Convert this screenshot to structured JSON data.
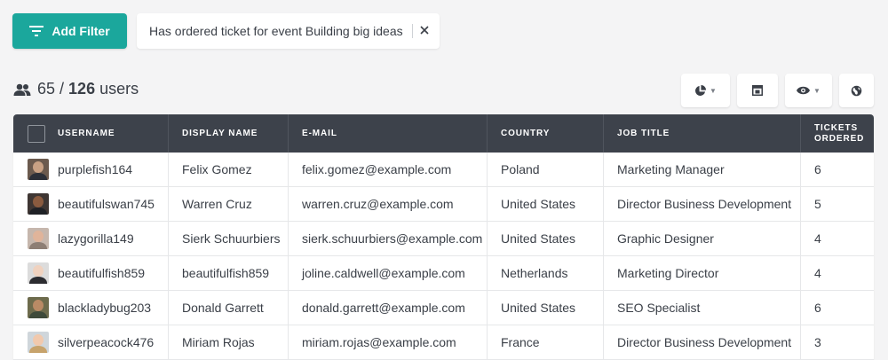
{
  "filter_bar": {
    "add_filter_label": "Add Filter",
    "active_filter": "Has ordered ticket for event Building big ideas",
    "close_icon": "close-icon"
  },
  "summary": {
    "shown": "65",
    "separator": "/",
    "total": "126",
    "unit": "users"
  },
  "toolbar": {
    "buttons": [
      "pie-chart-icon",
      "layout-icon",
      "eye-icon",
      "globe-icon"
    ]
  },
  "table": {
    "columns": [
      "Username",
      "Display Name",
      "E-mail",
      "Country",
      "Job Title",
      "Tickets Ordered"
    ],
    "rows": [
      {
        "username": "purplefish164",
        "display": "Felix Gomez",
        "email": "felix.gomez@example.com",
        "country": "Poland",
        "job": "Marketing Manager",
        "tickets": "6",
        "skin": "#c9a184",
        "shirt": "#2b2f38",
        "bg": "#6b5a4e"
      },
      {
        "username": "beautifulswan745",
        "display": "Warren Cruz",
        "email": "warren.cruz@example.com",
        "country": "United States",
        "job": "Director Business Development",
        "tickets": "5",
        "skin": "#8a5b3f",
        "shirt": "#1f2126",
        "bg": "#3e3633"
      },
      {
        "username": "lazygorilla149",
        "display": "Sierk Schuurbiers",
        "email": "sierk.schuurbiers@example.com",
        "country": "United States",
        "job": "Graphic Designer",
        "tickets": "4",
        "skin": "#e0b49a",
        "shirt": "#8d7e74",
        "bg": "#c6b7ad"
      },
      {
        "username": "beautifulfish859",
        "display": "beautifulfish859",
        "email": "joline.caldwell@example.com",
        "country": "Netherlands",
        "job": "Marketing Director",
        "tickets": "4",
        "skin": "#f0d2bf",
        "shirt": "#2c2c30",
        "bg": "#dcdcdc"
      },
      {
        "username": "blackladybug203",
        "display": "Donald Garrett",
        "email": "donald.garrett@example.com",
        "country": "United States",
        "job": "SEO Specialist",
        "tickets": "6",
        "skin": "#b98a65",
        "shirt": "#3e4a3a",
        "bg": "#6d6b4c"
      },
      {
        "username": "silverpeacock476",
        "display": "Miriam Rojas",
        "email": "miriam.rojas@example.com",
        "country": "France",
        "job": "Director Business Development",
        "tickets": "3",
        "skin": "#f1c9ad",
        "shirt": "#c7a36c",
        "bg": "#cfd6db"
      }
    ]
  },
  "colors": {
    "accent": "#1ba79c",
    "header_bg": "#3d424b",
    "page_bg": "#f4f4f5"
  }
}
